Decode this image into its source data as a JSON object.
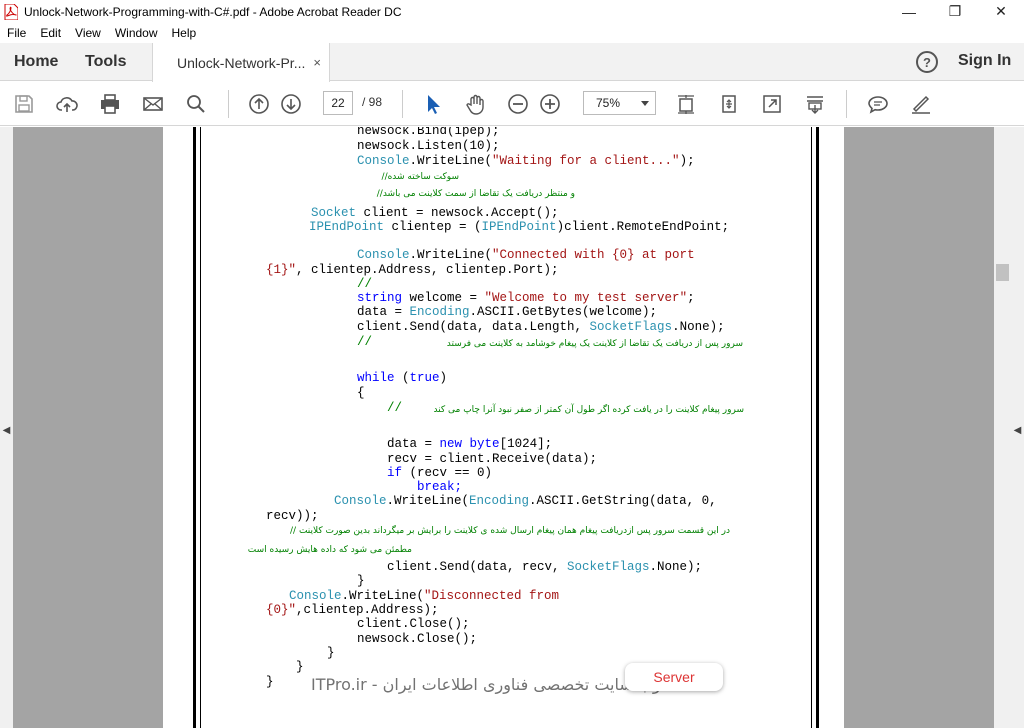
{
  "window": {
    "title": "Unlock-Network-Programming-with-C#.pdf - Adobe Acrobat Reader DC",
    "minimize": "—",
    "maximize": "❐",
    "close": "✕"
  },
  "menu": [
    "File",
    "Edit",
    "View",
    "Window",
    "Help"
  ],
  "tabs": {
    "home": "Home",
    "tools": "Tools",
    "document": "Unlock-Network-Pr...",
    "close": "×",
    "help": "?",
    "signin": "Sign In"
  },
  "toolbar": {
    "page_current": "22",
    "page_total": "/ 98",
    "zoom": "75%"
  },
  "code_lines": {
    "l1": "newsock.Bind(ipep);",
    "l2": "newsock.Listen(10);",
    "l3_a": "Console",
    "l3_b": ".WriteLine(",
    "l3_c": "\"Waiting for a client...\"",
    "l3_d": ");",
    "fa1": "سوکت ساخته شده//",
    "fa2": "و منتظر دریافت یک تقاضا از سمت کلاینت می باشد//",
    "l4_a": "Socket",
    "l4_b": " client = newsock.Accept();",
    "l5_a": "IPEndPoint",
    "l5_b": " clientep = (",
    "l5_c": "IPEndPoint",
    "l5_d": ")client.RemoteEndPoint;",
    "l6_a": "Console",
    "l6_b": ".WriteLine(",
    "l6_c": "\"Connected with {0} at port",
    "l7_a": "{1}\"",
    "l7_b": ", clientep.Address, clientep.Port);",
    "l8": "//",
    "l9_a": "string",
    "l9_b": " welcome = ",
    "l9_c": "\"Welcome to my test server\"",
    "l9_d": ";",
    "l10_a": "data = ",
    "l10_b": "Encoding",
    "l10_c": ".ASCII.GetBytes(welcome);",
    "l11_a": "client.Send(data, data.Length, ",
    "l11_b": "SocketFlags",
    "l11_c": ".None);",
    "l12_a": "//",
    "fa3": "سرور پس از دریافت یک تقاضا از کلاینت یک پیغام خوشامد به کلاینت می فرستد",
    "l13_a": "while",
    "l13_b": " (",
    "l13_c": "true",
    "l13_d": ")",
    "l14": "{",
    "l15_a": "//",
    "fa4": "سرور پیغام کلاینت را در یافت کرده اگر طول آن کمتر از صفر نبود آنرا چاپ می کند",
    "l16_a": "data = ",
    "l16_b": "new",
    "l16_c": " ",
    "l16_d": "byte",
    "l16_e": "[1024];",
    "l17": "recv = client.Receive(data);",
    "l18_a": "if",
    "l18_b": " (recv == 0)",
    "l19": "break;",
    "l20_a": "Console",
    "l20_b": ".WriteLine(",
    "l20_c": "Encoding",
    "l20_d": ".ASCII.GetString(data, 0,",
    "l21": "recv));",
    "fa5": "در این قسمت سرور پس ازدریافت پیغام همان پیغام ارسال شده ی کلاینت را برایش بر میگرداند بدین صورت کلاینت //",
    "fa6": "مطمئن می شود که داده هایش رسیده است",
    "l22_a": "client.Send(data, recv, ",
    "l22_b": "SocketFlags",
    "l22_c": ".None);",
    "l23": "}",
    "l24_a": "Console",
    "l24_b": ".WriteLine(",
    "l24_c": "\"Disconnected from",
    "l25_a": "{0}\"",
    "l25_b": ",clientep.Address);",
    "l26": "client.Close();",
    "l27": "newsock.Close();",
    "l28": "}",
    "l29": "}",
    "l30": "}"
  },
  "overlay": {
    "watermark": "وب سایت تخصصی فناوری اطلاعات ایران - ITPro.ir",
    "server_label": "Server"
  },
  "colors": {
    "keyword": "#0000ff",
    "type": "#2b91af",
    "string": "#a31515",
    "comment": "#008000"
  }
}
